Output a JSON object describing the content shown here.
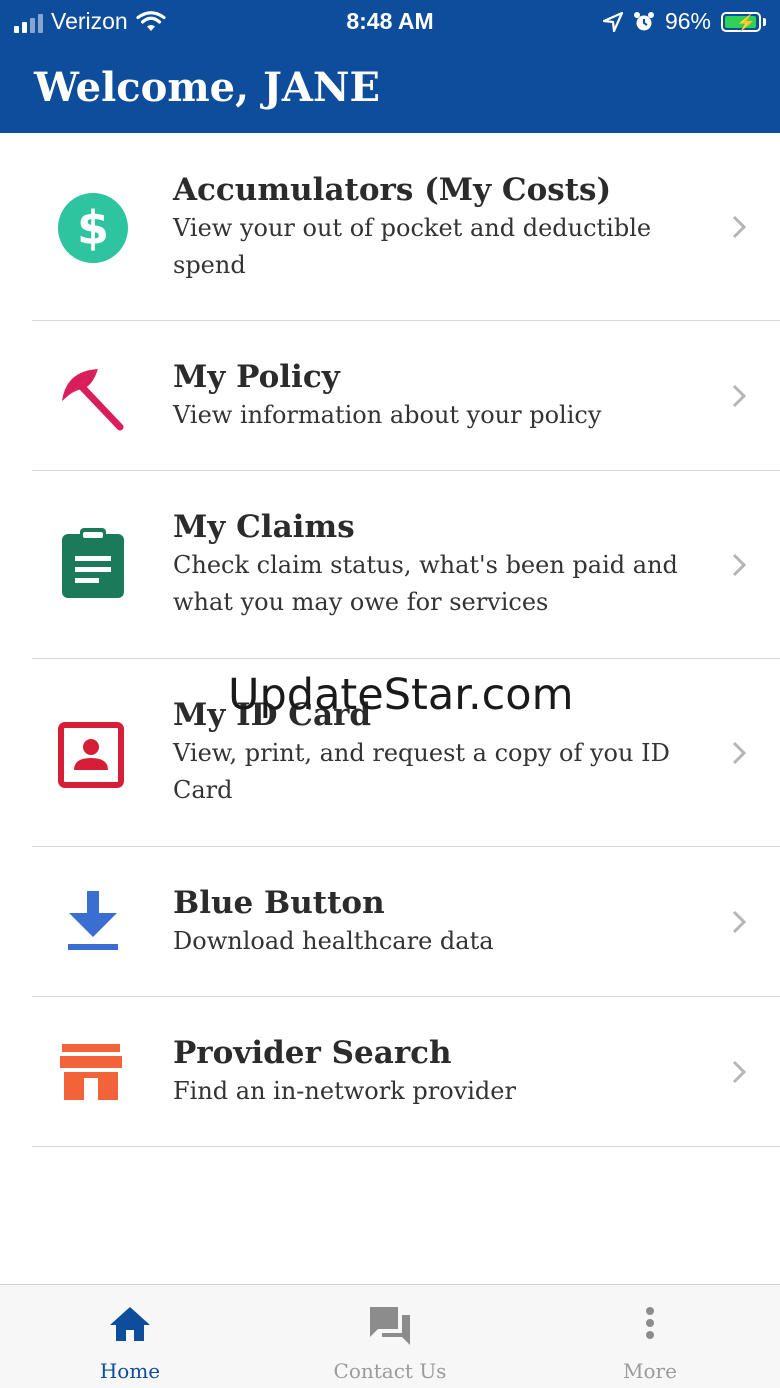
{
  "status_bar": {
    "carrier": "Verizon",
    "time": "8:48 AM",
    "battery_percent": "96%",
    "battery_level": 0.96,
    "icons": [
      "signal-icon",
      "wifi-icon",
      "location-icon",
      "alarm-icon",
      "battery-icon"
    ]
  },
  "header": {
    "title": "Welcome, JANE",
    "background_color": "#0d4d9c"
  },
  "menu": {
    "items": [
      {
        "title": "Accumulators (My Costs)",
        "description": "View your out of pocket and deductible spend",
        "icon": "dollar-icon",
        "icon_color": "#2ec4a0"
      },
      {
        "title": "My Policy",
        "description": "View information about your policy",
        "icon": "umbrella-icon",
        "icon_color": "#d81e5b"
      },
      {
        "title": "My Claims",
        "description": "Check claim status, what's been paid and what you may owe for services",
        "icon": "clipboard-icon",
        "icon_color": "#1b7a5a"
      },
      {
        "title": "My ID Card",
        "description": "View, print, and request a copy of you ID Card",
        "icon": "id-card-icon",
        "icon_color": "#d61f36"
      },
      {
        "title": "Blue Button",
        "description": "Download healthcare data",
        "icon": "download-icon",
        "icon_color": "#3a6fd1"
      },
      {
        "title": "Provider Search",
        "description": "Find an in-network provider",
        "icon": "storefront-icon",
        "icon_color": "#f2633a"
      }
    ]
  },
  "watermark": "UpdateStar.com",
  "tab_bar": {
    "tabs": [
      {
        "label": "Home",
        "icon": "home-icon",
        "active": true
      },
      {
        "label": "Contact Us",
        "icon": "chat-icon",
        "active": false
      },
      {
        "label": "More",
        "icon": "more-vertical-icon",
        "active": false
      }
    ],
    "active_color": "#0d4d9c",
    "inactive_color": "#9b9b9b"
  }
}
